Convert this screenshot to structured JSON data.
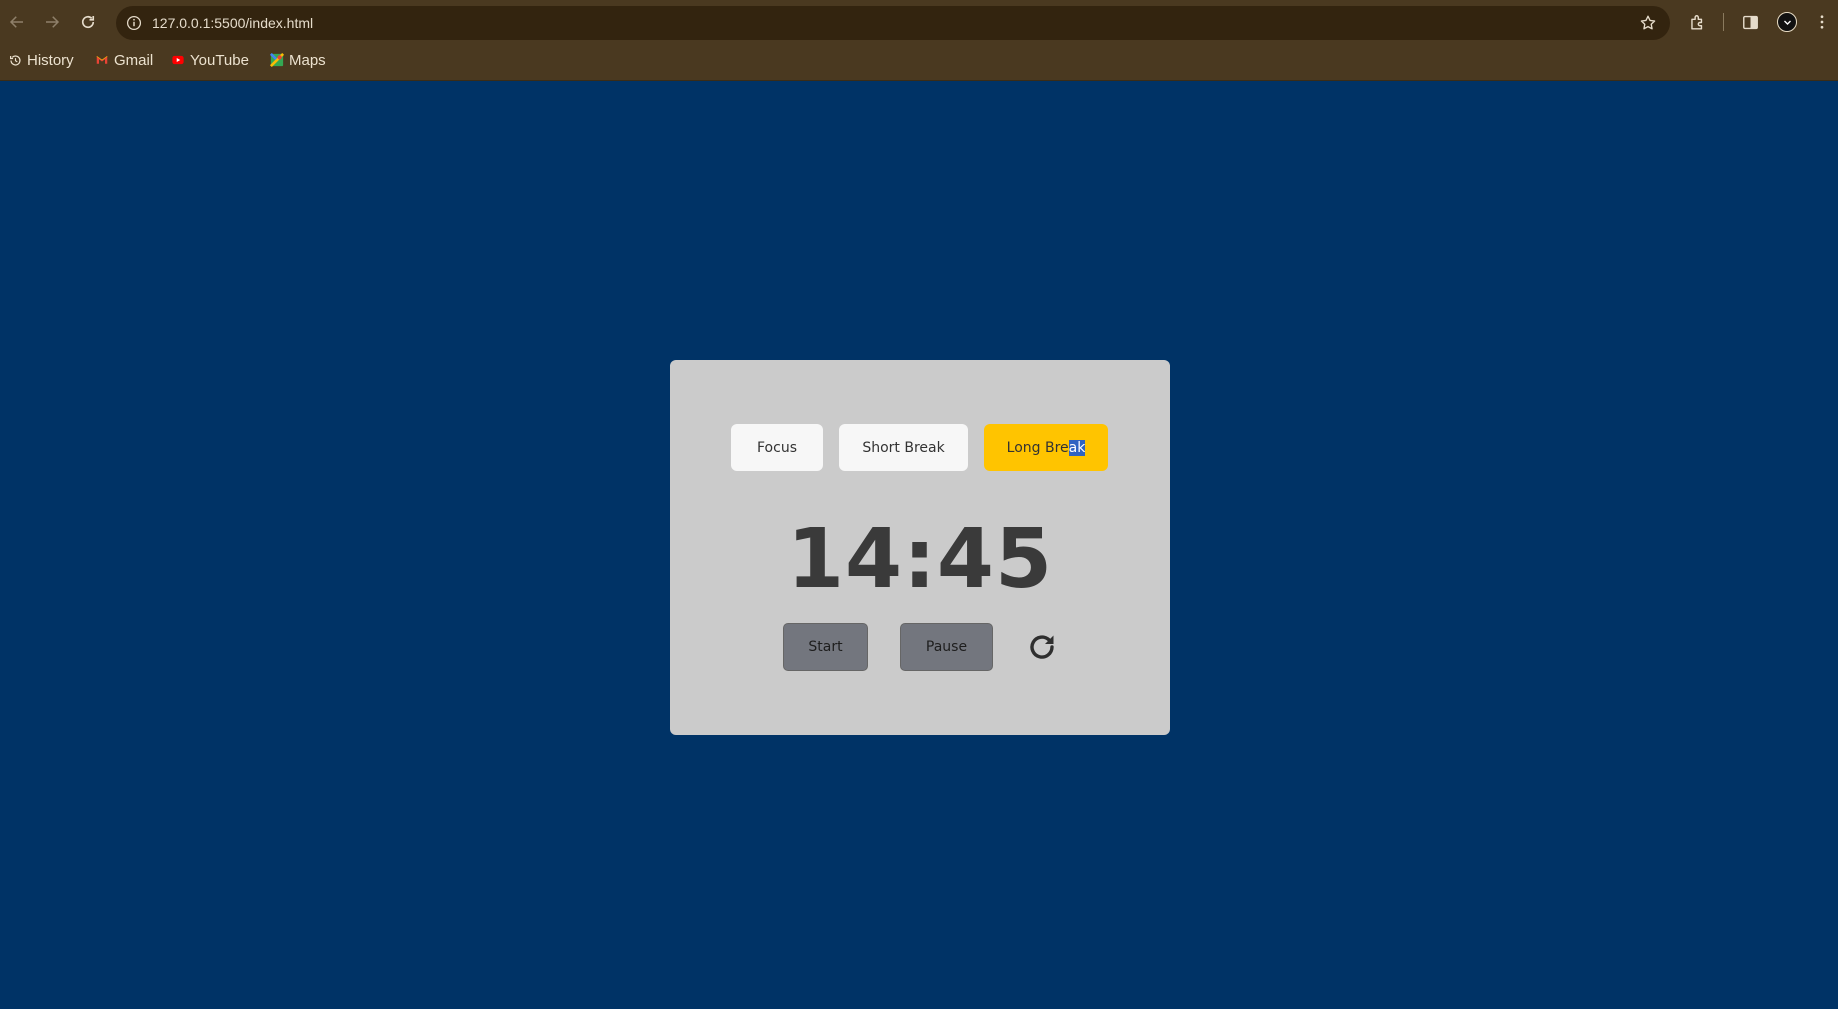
{
  "browser": {
    "url": "127.0.0.1:5500/index.html",
    "bookmarks": [
      {
        "label": "History",
        "icon": "history-icon"
      },
      {
        "label": "Gmail",
        "icon": "gmail-icon"
      },
      {
        "label": "YouTube",
        "icon": "youtube-icon"
      },
      {
        "label": "Maps",
        "icon": "maps-icon"
      }
    ],
    "colors": {
      "chrome": "#4a3920",
      "omnibox": "#33240f"
    }
  },
  "timer": {
    "modes": [
      {
        "label": "Focus",
        "active": false
      },
      {
        "label": "Short Break",
        "active": false
      },
      {
        "label_start": "Long Bre",
        "label_selected": "ak",
        "active": true
      }
    ],
    "time": "14:45",
    "controls": {
      "start": "Start",
      "pause": "Pause",
      "reset_icon": "reset-icon"
    },
    "colors": {
      "page_bg": "#003366",
      "card_bg": "#cbcbcb",
      "active_mode": "#ffc400",
      "button": "#73767e"
    }
  }
}
